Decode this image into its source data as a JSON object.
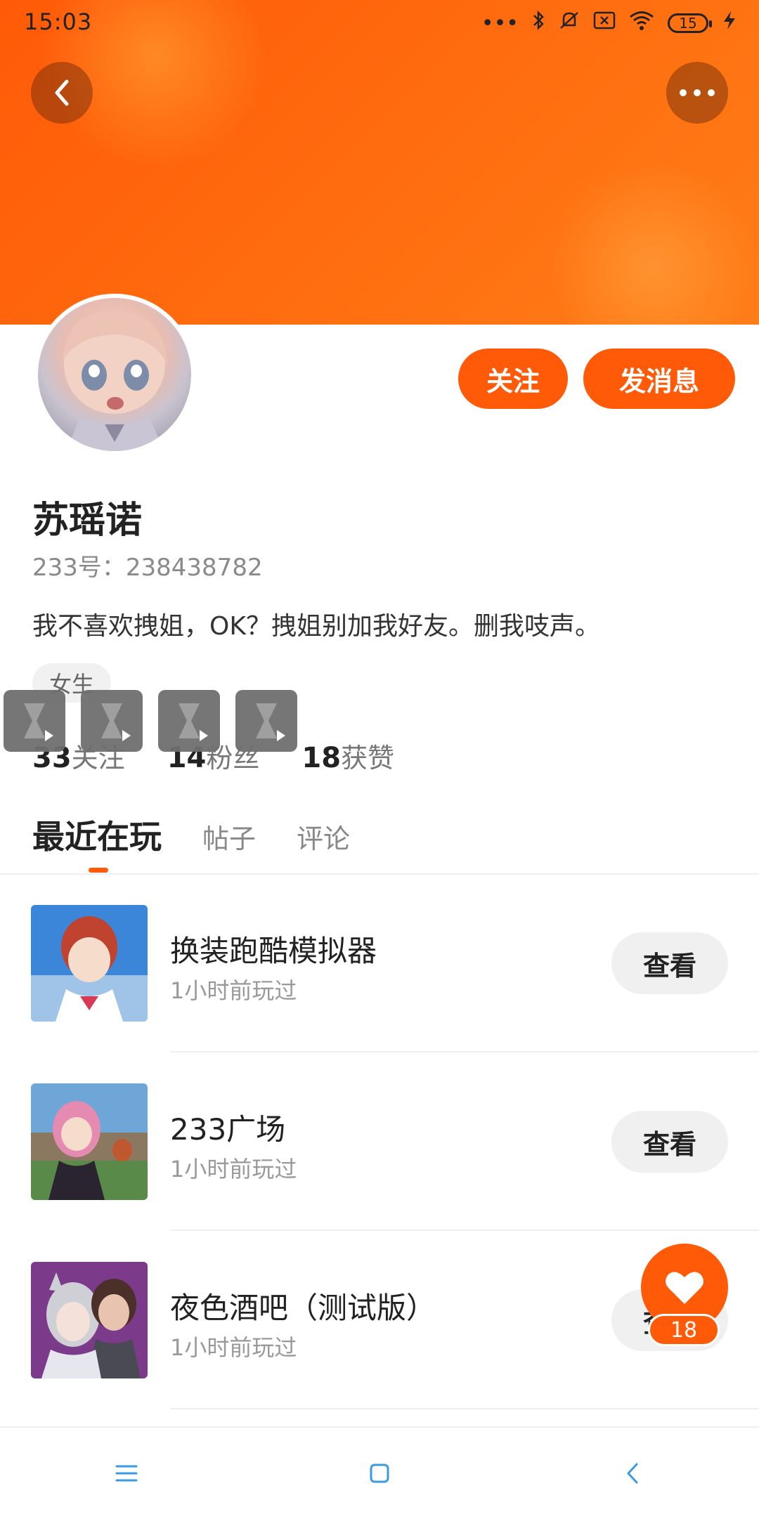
{
  "status_bar": {
    "time": "15:03",
    "battery_level": "15",
    "icons": [
      "more-dots-icon",
      "bluetooth-icon",
      "mute-icon",
      "no-sim-icon",
      "wifi-icon",
      "battery-icon",
      "charging-icon"
    ]
  },
  "header": {
    "back_icon": "chevron-left-icon",
    "more_icon": "more-horizontal-icon"
  },
  "actions": {
    "follow_label": "关注",
    "message_label": "发消息"
  },
  "profile": {
    "name": "苏瑶诺",
    "id_text": "233号：238438782",
    "bio": "我不喜欢拽姐，OK？拽姐别加我好友。删我吱声。",
    "tag": "女生"
  },
  "stats": [
    {
      "value": "33",
      "label": "关注"
    },
    {
      "value": "14",
      "label": "粉丝"
    },
    {
      "value": "18",
      "label": "获赞"
    }
  ],
  "tabs": [
    {
      "label": "最近在玩",
      "active": true
    },
    {
      "label": "帖子",
      "active": false
    },
    {
      "label": "评论",
      "active": false
    }
  ],
  "games": [
    {
      "title": "换装跑酷模拟器",
      "subtitle": "1小时前玩过",
      "button": "查看"
    },
    {
      "title": "233广场",
      "subtitle": "1小时前玩过",
      "button": "查看"
    },
    {
      "title": "夜色酒吧（测试版）",
      "subtitle": "1小时前玩过",
      "button": "查看"
    }
  ],
  "like": {
    "count": "18"
  },
  "colors": {
    "accent": "#ff5a08",
    "text": "#222222",
    "muted": "#8a8a8a",
    "nav_icon": "#3a9be0"
  }
}
